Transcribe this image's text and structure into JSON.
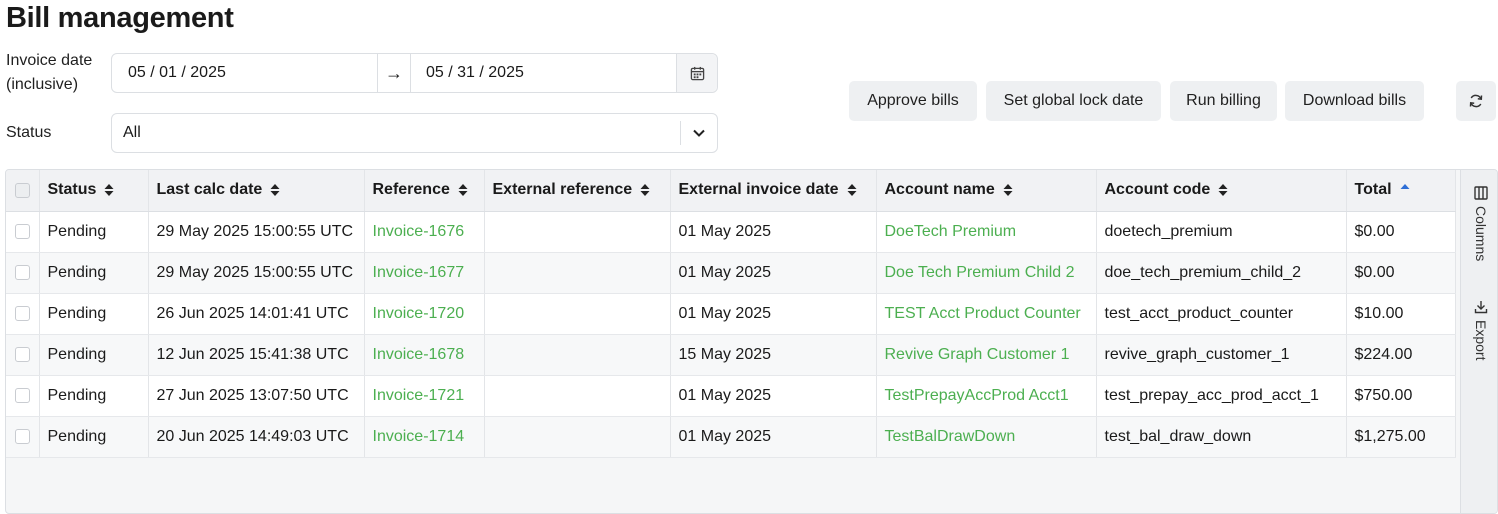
{
  "page": {
    "title": "Bill management"
  },
  "filters": {
    "invoice_date_label": "Invoice date (inclusive)",
    "start_date": "05 / 01 / 2025",
    "arrow": "→",
    "end_date": "05 / 31 / 2025",
    "status_label": "Status",
    "status_value": "All"
  },
  "actions": {
    "approve": "Approve bills",
    "lock": "Set global lock date",
    "run": "Run billing",
    "download": "Download bills"
  },
  "table": {
    "columns": [
      "Status",
      "Last calc date",
      "Reference",
      "External reference",
      "External invoice date",
      "Account name",
      "Account code",
      "Total"
    ],
    "rows": [
      {
        "status": "Pending",
        "last_calc": "29 May 2025 15:00:55 UTC",
        "reference": "Invoice-1676",
        "ext_ref": "",
        "ext_date": "01 May 2025",
        "account_name": "DoeTech Premium",
        "account_code": "doetech_premium",
        "total": "$0.00"
      },
      {
        "status": "Pending",
        "last_calc": "29 May 2025 15:00:55 UTC",
        "reference": "Invoice-1677",
        "ext_ref": "",
        "ext_date": "01 May 2025",
        "account_name": "Doe Tech Premium Child 2",
        "account_code": "doe_tech_premium_child_2",
        "total": "$0.00"
      },
      {
        "status": "Pending",
        "last_calc": "26 Jun 2025 14:01:41 UTC",
        "reference": "Invoice-1720",
        "ext_ref": "",
        "ext_date": "01 May 2025",
        "account_name": "TEST Acct Product Counter",
        "account_code": "test_acct_product_counter",
        "total": "$10.00"
      },
      {
        "status": "Pending",
        "last_calc": "12 Jun 2025 15:41:38 UTC",
        "reference": "Invoice-1678",
        "ext_ref": "",
        "ext_date": "15 May 2025",
        "account_name": "Revive Graph Customer 1",
        "account_code": "revive_graph_customer_1",
        "total": "$224.00"
      },
      {
        "status": "Pending",
        "last_calc": "27 Jun 2025 13:07:50 UTC",
        "reference": "Invoice-1721",
        "ext_ref": "",
        "ext_date": "01 May 2025",
        "account_name": "TestPrepayAccProd Acct1",
        "account_code": "test_prepay_acc_prod_acct_1",
        "total": "$750.00"
      },
      {
        "status": "Pending",
        "last_calc": "20 Jun 2025 14:49:03 UTC",
        "reference": "Invoice-1714",
        "ext_ref": "",
        "ext_date": "01 May 2025",
        "account_name": "TestBalDrawDown",
        "account_code": "test_bal_draw_down",
        "total": "$1,275.00"
      }
    ],
    "sorted_column": "Total",
    "sort_direction": "ascending"
  },
  "side_panel": {
    "columns": "Columns",
    "export": "Export"
  },
  "colors": {
    "link": "#4caf50",
    "sort_active": "#2f6fd6",
    "button_bg": "#eef0f2"
  },
  "icons": {
    "calendar": "calendar-icon",
    "chevron": "chevron-down-icon",
    "refresh": "refresh-icon",
    "sort": "sort-icon",
    "columns": "columns-icon",
    "export": "download-icon"
  }
}
